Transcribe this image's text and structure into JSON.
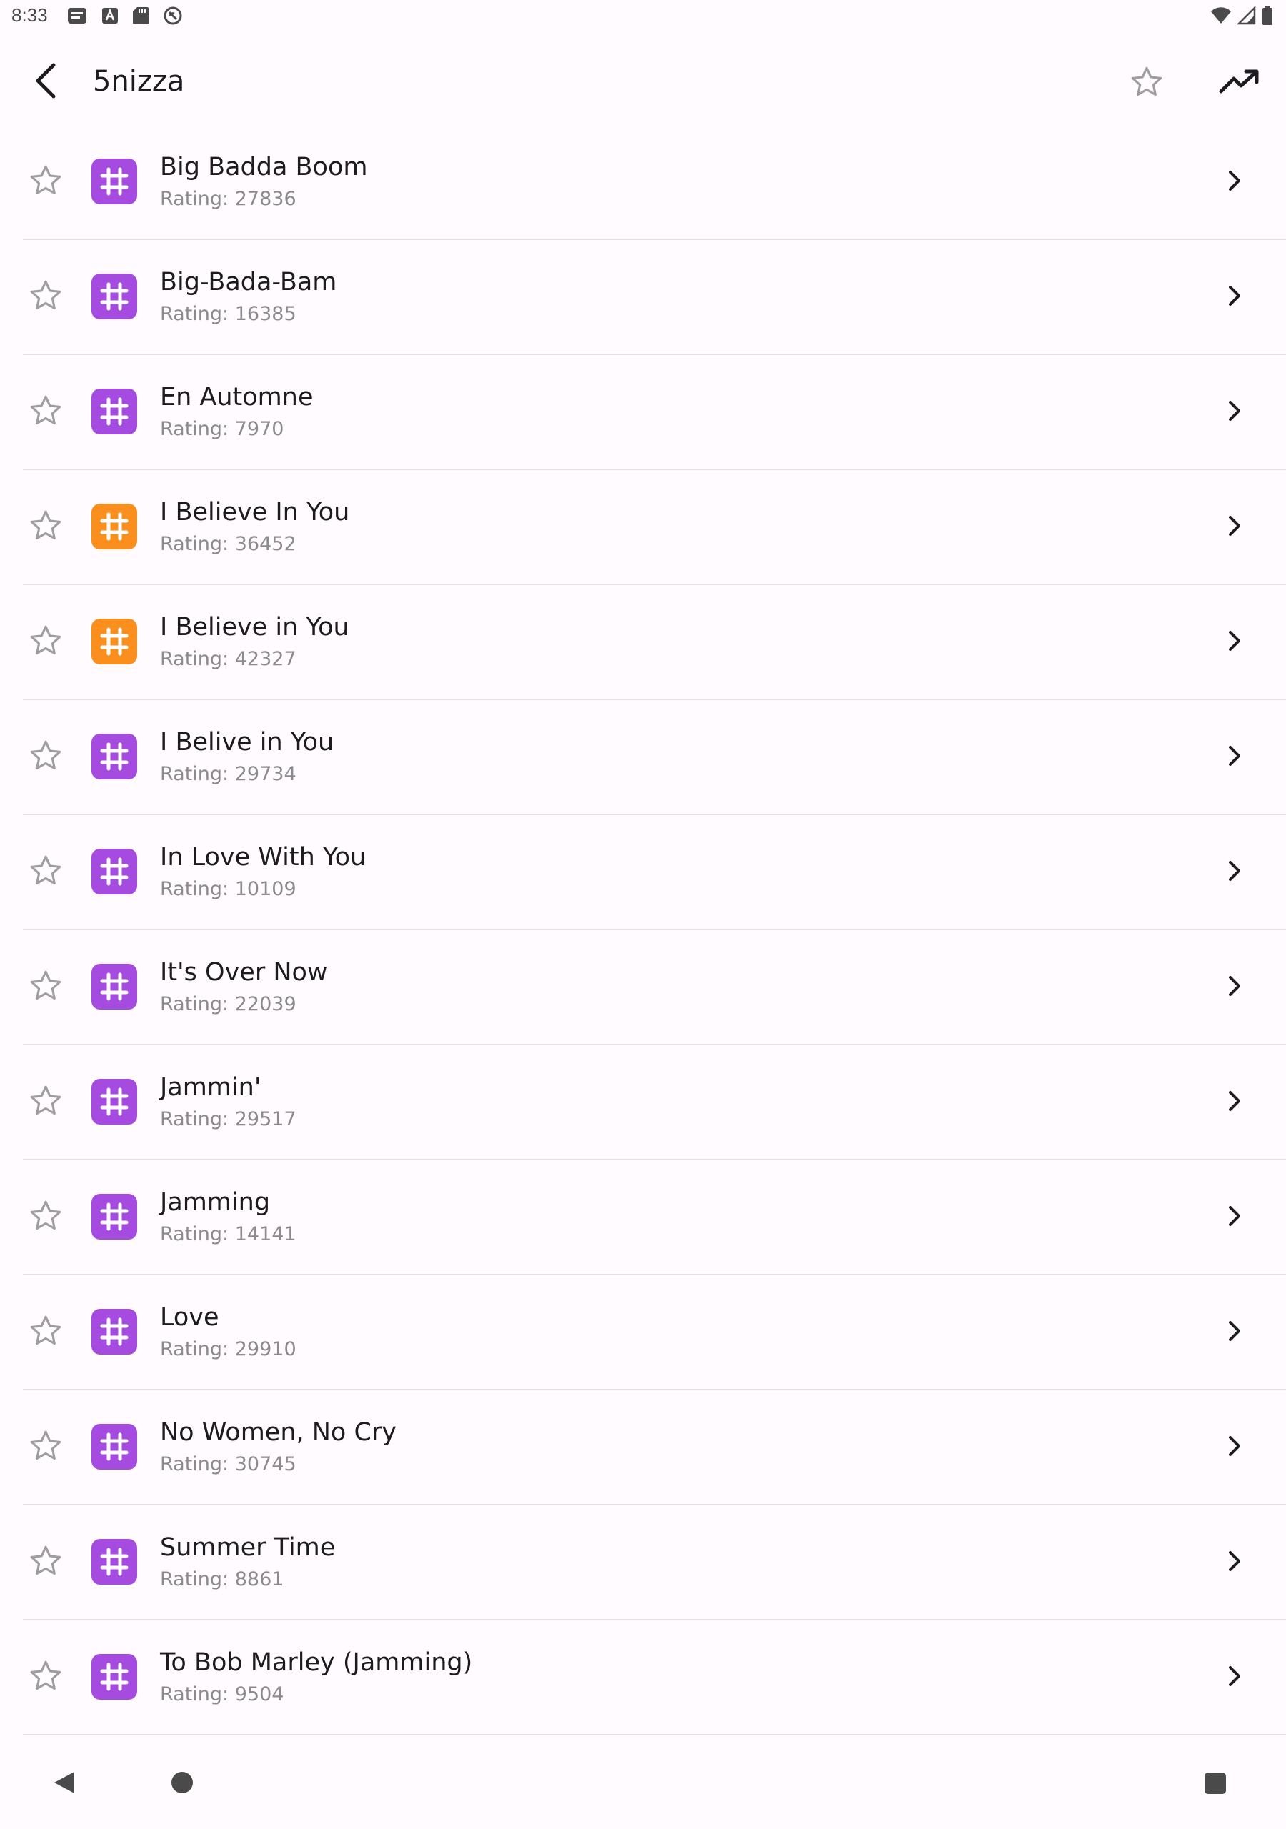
{
  "status_bar": {
    "time": "8:33",
    "left_icons": [
      "notes-icon",
      "font-icon",
      "sd-card-icon",
      "no-sync-icon"
    ],
    "right_icons": [
      "wifi-icon",
      "signal-icon",
      "battery-icon"
    ]
  },
  "app_bar": {
    "title": "5nizza",
    "back_icon": "back-arrow-icon",
    "favorite_icon": "star-outline-icon",
    "trending_icon": "trending-up-icon"
  },
  "colors": {
    "purple_badge": "#A64BDF",
    "orange_badge": "#FA8F1E",
    "background": "#FFFBFE",
    "divider": "#E4E0E6",
    "secondary_text": "#8A8A8F"
  },
  "songs": [
    {
      "title": "Big Badda Boom",
      "rating": "Rating: 27836",
      "badge": "purple"
    },
    {
      "title": "Big-Bada-Bam",
      "rating": "Rating: 16385",
      "badge": "purple"
    },
    {
      "title": "En Automne",
      "rating": "Rating: 7970",
      "badge": "purple"
    },
    {
      "title": "I Believe In You",
      "rating": "Rating: 36452",
      "badge": "orange"
    },
    {
      "title": "I Believe in You",
      "rating": "Rating: 42327",
      "badge": "orange"
    },
    {
      "title": "I Belive in You",
      "rating": "Rating: 29734",
      "badge": "purple"
    },
    {
      "title": "In Love With You",
      "rating": "Rating: 10109",
      "badge": "purple"
    },
    {
      "title": "It's Over Now",
      "rating": "Rating: 22039",
      "badge": "purple"
    },
    {
      "title": "Jammin'",
      "rating": "Rating: 29517",
      "badge": "purple"
    },
    {
      "title": "Jamming",
      "rating": "Rating: 14141",
      "badge": "purple"
    },
    {
      "title": "Love",
      "rating": "Rating: 29910",
      "badge": "purple"
    },
    {
      "title": "No Women, No Cry",
      "rating": "Rating: 30745",
      "badge": "purple"
    },
    {
      "title": "Summer Time",
      "rating": "Rating: 8861",
      "badge": "purple"
    },
    {
      "title": "To Bob Marley (Jamming)",
      "rating": "Rating: 9504",
      "badge": "purple"
    }
  ],
  "nav_bar": {
    "icons": [
      "nav-back-icon",
      "nav-home-icon",
      "nav-recents-icon"
    ]
  }
}
